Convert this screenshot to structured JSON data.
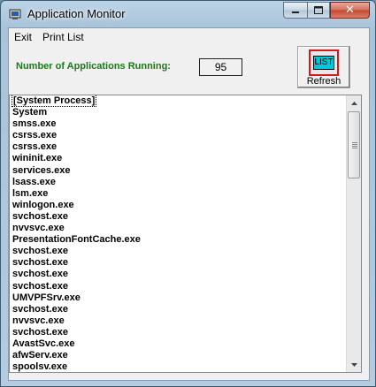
{
  "window": {
    "title": "Application Monitor",
    "close_glyph": "✕"
  },
  "menu": {
    "exit": "Exit",
    "print_list": "Print List"
  },
  "count": {
    "label": "Number of Applications Running:",
    "value": "95"
  },
  "refresh": {
    "icon_text": "LIST",
    "label": "Refresh"
  },
  "processes": [
    "[System Process]",
    "System",
    "smss.exe",
    "csrss.exe",
    "csrss.exe",
    "wininit.exe",
    "services.exe",
    "lsass.exe",
    "lsm.exe",
    "winlogon.exe",
    "svchost.exe",
    "nvvsvc.exe",
    "PresentationFontCache.exe",
    "svchost.exe",
    "svchost.exe",
    "svchost.exe",
    "svchost.exe",
    "UMVPFSrv.exe",
    "svchost.exe",
    "nvvsvc.exe",
    "svchost.exe",
    "AvastSvc.exe",
    "afwServ.exe",
    "spoolsv.exe"
  ],
  "icons": {
    "app": "application-monitor-icon",
    "minimize": "minimize-icon",
    "maximize": "maximize-icon",
    "close": "close-icon"
  }
}
